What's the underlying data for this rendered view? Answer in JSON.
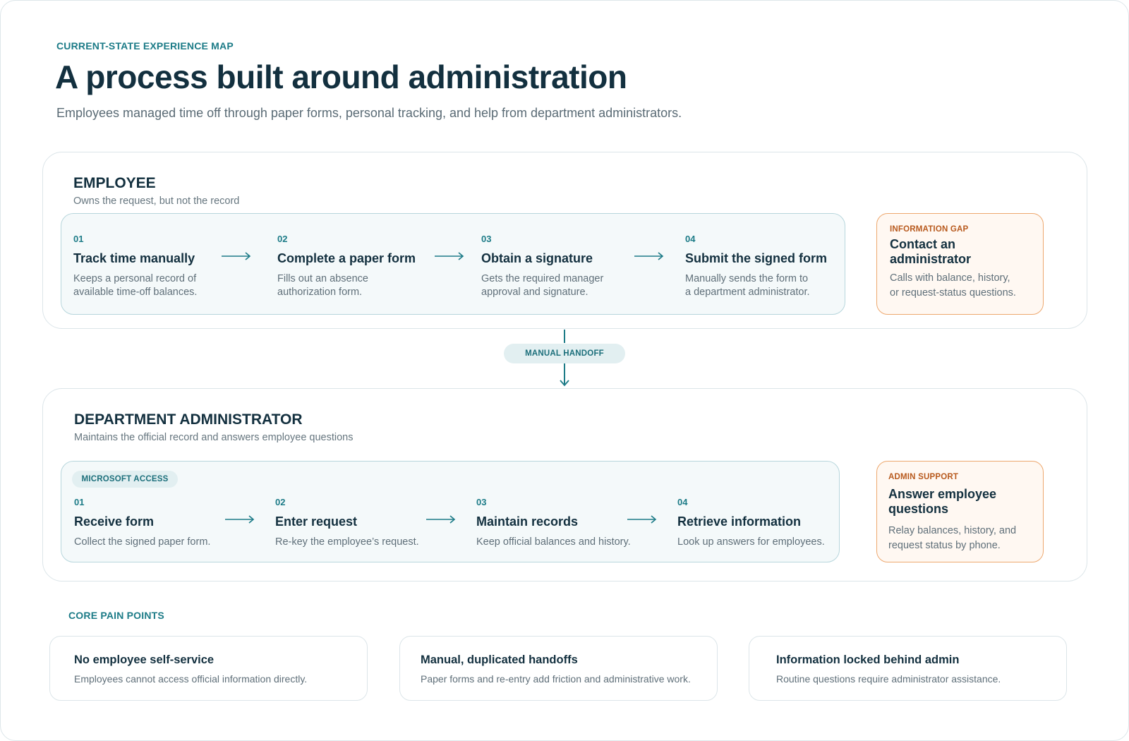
{
  "header": {
    "eyebrow": "CURRENT-STATE EXPERIENCE MAP",
    "title": "A process built around administration",
    "subtitle": "Employees managed time off through paper forms, personal tracking, and help from department administrators."
  },
  "employee_lane": {
    "title": "EMPLOYEE",
    "description": "Owns the request, but not the record",
    "steps": [
      {
        "num": "01",
        "title": "Track time manually",
        "desc": [
          "Keeps a personal record of",
          "available time-off balances."
        ]
      },
      {
        "num": "02",
        "title": "Complete a paper form",
        "desc": [
          "Fills out an absence",
          "authorization form."
        ]
      },
      {
        "num": "03",
        "title": "Obtain a signature",
        "desc": [
          "Gets the required manager",
          "approval and signature."
        ]
      },
      {
        "num": "04",
        "title": "Submit the signed form",
        "desc": [
          "Manually sends the form to",
          "a department administrator."
        ]
      }
    ],
    "side": {
      "tag": "INFORMATION GAP",
      "title": [
        "Contact an",
        "administrator"
      ],
      "desc": [
        "Calls with balance, history,",
        "or request-status questions."
      ]
    }
  },
  "handoff": {
    "label": "MANUAL HANDOFF"
  },
  "admin_lane": {
    "title": "DEPARTMENT ADMINISTRATOR",
    "description": "Maintains the official record and answers employee questions",
    "tool_badge": "MICROSOFT ACCESS",
    "steps": [
      {
        "num": "01",
        "title": "Receive form",
        "desc": [
          "Collect the signed paper form."
        ]
      },
      {
        "num": "02",
        "title": "Enter request",
        "desc": [
          "Re-key the employee’s request."
        ]
      },
      {
        "num": "03",
        "title": "Maintain records",
        "desc": [
          "Keep official balances and history."
        ]
      },
      {
        "num": "04",
        "title": "Retrieve information",
        "desc": [
          "Look up answers for employees."
        ]
      }
    ],
    "side": {
      "tag": "ADMIN SUPPORT",
      "title": [
        "Answer employee",
        "questions"
      ],
      "desc": [
        "Relay balances, history, and",
        "request status by phone."
      ]
    }
  },
  "pain_points": {
    "label": "CORE PAIN POINTS",
    "items": [
      {
        "title": "No employee self-service",
        "desc": "Employees cannot access official information directly."
      },
      {
        "title": "Manual, duplicated handoffs",
        "desc": "Paper forms and re-entry add friction and administrative work."
      },
      {
        "title": "Information locked behind admin",
        "desc": "Routine questions require administrator assistance."
      }
    ]
  },
  "colors": {
    "accent": "#1c7b87",
    "warning": "#b85a1e",
    "heading": "#13303f"
  }
}
